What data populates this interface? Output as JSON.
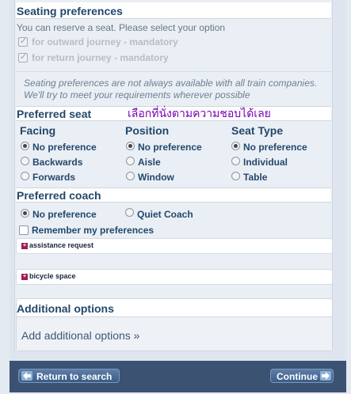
{
  "header": {
    "title": "Seating preferences"
  },
  "intro": "You can reserve a seat. Please select your option",
  "journeys": [
    {
      "label": "for outward journey - mandatory",
      "checked": true
    },
    {
      "label": "for return journey - mandatory",
      "checked": true
    }
  ],
  "notice": {
    "line1": "Seating preferences are not always available with all train companies.",
    "line2": "We'll try to meet your requirements wherever possible"
  },
  "preferred_seat": {
    "title": "Preferred seat",
    "annotation": "เลือกที่นั่งตามความชอบได้เลย",
    "facing": {
      "heading": "Facing",
      "options": [
        "No preference",
        "Backwards",
        "Forwards"
      ],
      "selected": "No preference"
    },
    "position": {
      "heading": "Position",
      "options": [
        "No preference",
        "Aisle",
        "Window"
      ],
      "selected": "No preference"
    },
    "seat_type": {
      "heading": "Seat Type",
      "options": [
        "No preference",
        "Individual",
        "Table"
      ],
      "selected": "No preference"
    }
  },
  "preferred_coach": {
    "title": "Preferred coach",
    "options": [
      "No preference",
      "Quiet Coach"
    ],
    "selected": "No preference",
    "remember_label": "Remember my preferences",
    "remember_checked": false
  },
  "links": {
    "assistance": "assistance request",
    "bicycle": "bicycle space"
  },
  "additional": {
    "title": "Additional options",
    "link": "Add additional options »"
  },
  "footer": {
    "back_label": "Return to search",
    "continue_label": "Continue"
  },
  "colors": {
    "heading": "#23486c",
    "footer": "#3c5273",
    "annotation": "#7a00b8",
    "link_marker": "#a01b5a"
  },
  "icons": {
    "back": "arrow-left-icon",
    "continue": "arrow-right-icon",
    "expand": "plus-square-icon"
  }
}
